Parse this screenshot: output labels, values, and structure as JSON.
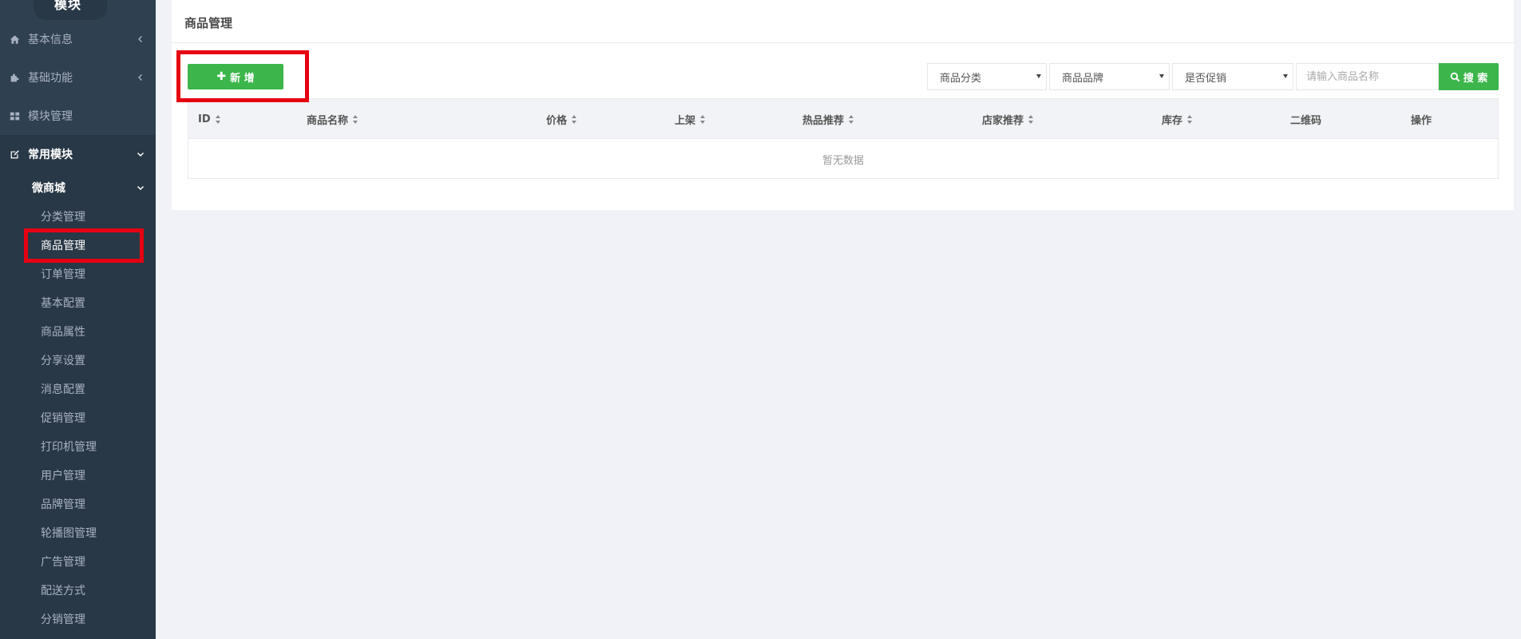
{
  "sidebar": {
    "logo": "模块",
    "menu": [
      {
        "label": "基本信息",
        "icon": "home-icon"
      },
      {
        "label": "基础功能",
        "icon": "puzzle-icon"
      },
      {
        "label": "模块管理",
        "icon": "grid-icon"
      },
      {
        "label": "常用模块",
        "icon": "edit-icon"
      }
    ],
    "submenu_title": "微商城",
    "submenu": [
      "分类管理",
      "商品管理",
      "订单管理",
      "基本配置",
      "商品属性",
      "分享设置",
      "消息配置",
      "促销管理",
      "打印机管理",
      "用户管理",
      "品牌管理",
      "轮播图管理",
      "广告管理",
      "配送方式",
      "分销管理"
    ],
    "active_item": "商品管理"
  },
  "main": {
    "title": "商品管理",
    "add_button": "新 增",
    "filters": {
      "category": "商品分类",
      "brand": "商品品牌",
      "promotion": "是否促销"
    },
    "search": {
      "placeholder": "请输入商品名称",
      "button": "搜 索"
    },
    "table": {
      "columns": [
        "ID",
        "商品名称",
        "价格",
        "上架",
        "热品推荐",
        "店家推荐",
        "库存",
        "二维码",
        "操作"
      ],
      "empty_text": "暂无数据"
    }
  },
  "colors": {
    "sidebar_bg": "#2f4050",
    "accent_green": "#3cb64b",
    "highlight_red": "#e60012"
  }
}
